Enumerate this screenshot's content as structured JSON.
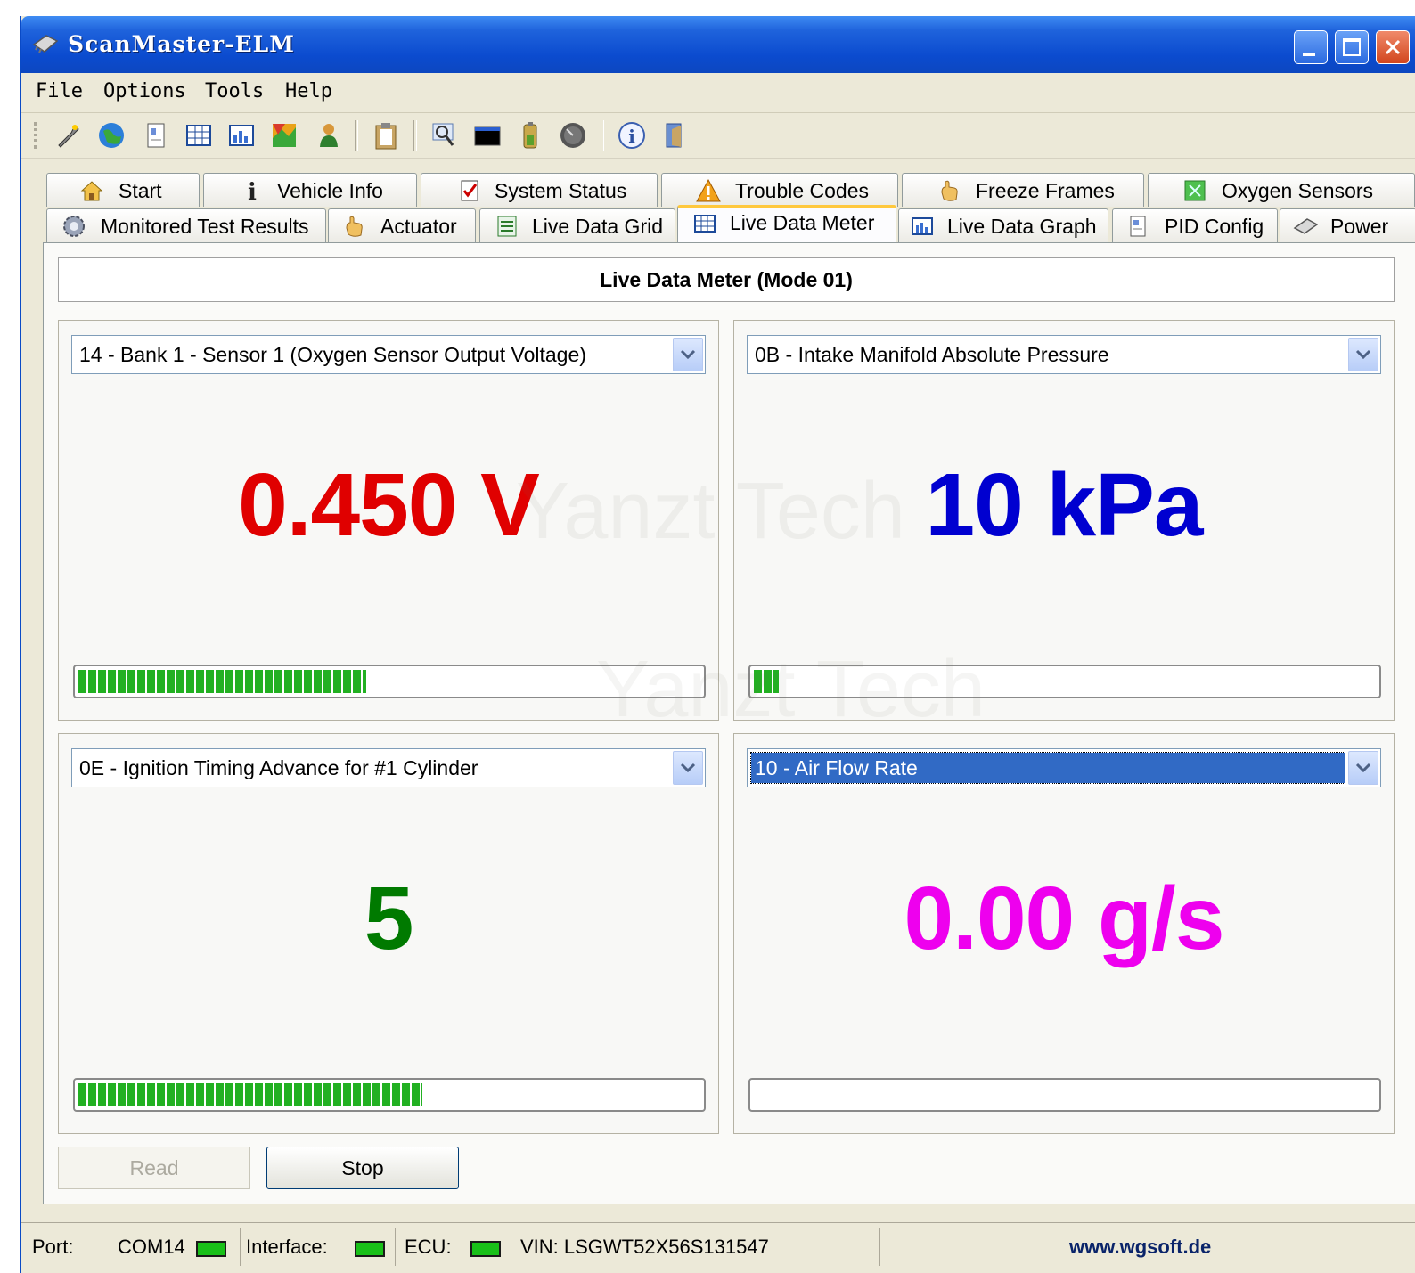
{
  "window": {
    "title": "ScanMaster-ELM"
  },
  "menu": [
    "File",
    "Options",
    "Tools",
    "Help"
  ],
  "toolbar_icons": [
    "wrench-icon",
    "globe-icon",
    "document-icon",
    "grid-icon",
    "chart-icon",
    "map-icon",
    "person-icon",
    "clipboard-icon",
    "magnifier-icon",
    "terminal-icon",
    "battery-icon",
    "gauge-icon",
    "info-icon",
    "exit-icon"
  ],
  "tabs_row1": [
    {
      "label": "Start",
      "icon": "house-icon"
    },
    {
      "label": "Vehicle Info",
      "icon": "info-icon"
    },
    {
      "label": "System Status",
      "icon": "checkbox-icon"
    },
    {
      "label": "Trouble Codes",
      "icon": "warning-icon"
    },
    {
      "label": "Freeze Frames",
      "icon": "hand-icon"
    },
    {
      "label": "Oxygen Sensors",
      "icon": "sensor-icon"
    }
  ],
  "tabs_row2": [
    {
      "label": "Monitored Test Results",
      "icon": "gear-icon"
    },
    {
      "label": "Actuator",
      "icon": "hand-icon"
    },
    {
      "label": "Live Data Grid",
      "icon": "list-icon"
    },
    {
      "label": "Live Data Meter",
      "icon": "meter-icon",
      "active": true
    },
    {
      "label": "Live Data Graph",
      "icon": "graph-icon"
    },
    {
      "label": "PID Config",
      "icon": "config-icon"
    },
    {
      "label": "Power",
      "icon": "chip-icon"
    }
  ],
  "panel": {
    "heading": "Live Data Meter (Mode 01)"
  },
  "meters": [
    {
      "pid": "14 - Bank 1 - Sensor 1 (Oxygen Sensor Output Voltage)",
      "value": "0.450 V",
      "color": "#e00000",
      "level": 0.46
    },
    {
      "pid": "0B - Intake Manifold Absolute Pressure",
      "value": "10 kPa",
      "color": "#0000d0",
      "level": 0.04
    },
    {
      "pid": "0E - Ignition Timing Advance for #1 Cylinder",
      "value": "5",
      "color": "#007a00",
      "level": 0.55
    },
    {
      "pid": "10 - Air Flow Rate",
      "value": "0.00 g/s",
      "color": "#ee00ee",
      "level": 0.0,
      "selected": true
    }
  ],
  "buttons": {
    "read": "Read",
    "stop": "Stop"
  },
  "watermark": "Yanzt Tech",
  "status": {
    "port_label": "Port:",
    "port_value": "COM14",
    "interface_label": "Interface:",
    "ecu_label": "ECU:",
    "vin": "VIN: LSGWT52X56S131547",
    "site": "www.wgsoft.de",
    "led_color": "#19c019"
  }
}
